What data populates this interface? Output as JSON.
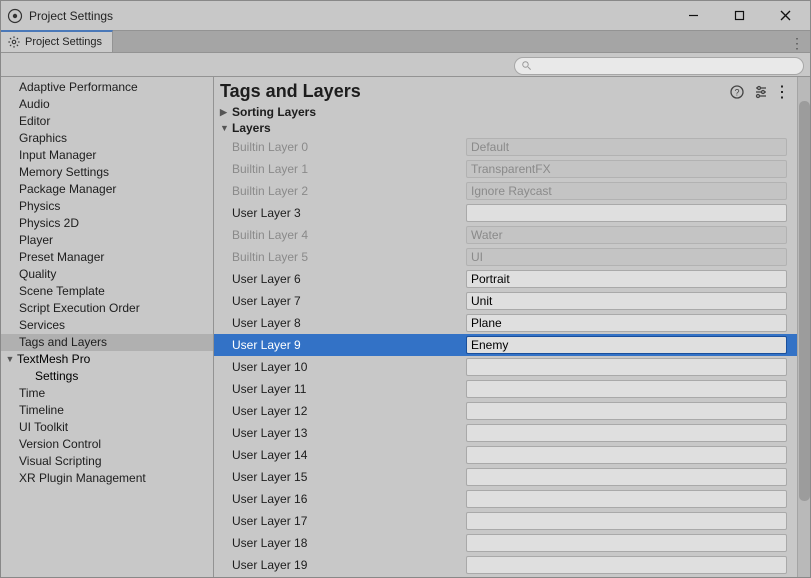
{
  "window": {
    "title": "Project Settings"
  },
  "tab": {
    "label": "Project Settings"
  },
  "search": {
    "placeholder": ""
  },
  "sidebar": {
    "items": [
      "Adaptive Performance",
      "Audio",
      "Editor",
      "Graphics",
      "Input Manager",
      "Memory Settings",
      "Package Manager",
      "Physics",
      "Physics 2D",
      "Player",
      "Preset Manager",
      "Quality",
      "Scene Template",
      "Script Execution Order",
      "Services",
      "Tags and Layers"
    ],
    "selected": "Tags and Layers",
    "group": {
      "label": "TextMesh Pro",
      "children": [
        "Settings"
      ],
      "expanded": true
    },
    "items2": [
      "Time",
      "Timeline",
      "UI Toolkit",
      "Version Control",
      "Visual Scripting",
      "XR Plugin Management"
    ]
  },
  "content": {
    "title": "Tags and Layers",
    "sections": {
      "sorting": {
        "label": "Sorting Layers",
        "expanded": false
      },
      "layers": {
        "label": "Layers",
        "expanded": true
      }
    },
    "layers": [
      {
        "label": "Builtin Layer 0",
        "value": "Default",
        "builtin": true,
        "selected": false
      },
      {
        "label": "Builtin Layer 1",
        "value": "TransparentFX",
        "builtin": true,
        "selected": false
      },
      {
        "label": "Builtin Layer 2",
        "value": "Ignore Raycast",
        "builtin": true,
        "selected": false
      },
      {
        "label": "User Layer 3",
        "value": "",
        "builtin": false,
        "selected": false
      },
      {
        "label": "Builtin Layer 4",
        "value": "Water",
        "builtin": true,
        "selected": false
      },
      {
        "label": "Builtin Layer 5",
        "value": "UI",
        "builtin": true,
        "selected": false
      },
      {
        "label": "User Layer 6",
        "value": "Portrait",
        "builtin": false,
        "selected": false
      },
      {
        "label": "User Layer 7",
        "value": "Unit",
        "builtin": false,
        "selected": false
      },
      {
        "label": "User Layer 8",
        "value": "Plane",
        "builtin": false,
        "selected": false
      },
      {
        "label": "User Layer 9",
        "value": "Enemy",
        "builtin": false,
        "selected": true
      },
      {
        "label": "User Layer 10",
        "value": "",
        "builtin": false,
        "selected": false
      },
      {
        "label": "User Layer 11",
        "value": "",
        "builtin": false,
        "selected": false
      },
      {
        "label": "User Layer 12",
        "value": "",
        "builtin": false,
        "selected": false
      },
      {
        "label": "User Layer 13",
        "value": "",
        "builtin": false,
        "selected": false
      },
      {
        "label": "User Layer 14",
        "value": "",
        "builtin": false,
        "selected": false
      },
      {
        "label": "User Layer 15",
        "value": "",
        "builtin": false,
        "selected": false
      },
      {
        "label": "User Layer 16",
        "value": "",
        "builtin": false,
        "selected": false
      },
      {
        "label": "User Layer 17",
        "value": "",
        "builtin": false,
        "selected": false
      },
      {
        "label": "User Layer 18",
        "value": "",
        "builtin": false,
        "selected": false
      },
      {
        "label": "User Layer 19",
        "value": "",
        "builtin": false,
        "selected": false
      }
    ]
  }
}
